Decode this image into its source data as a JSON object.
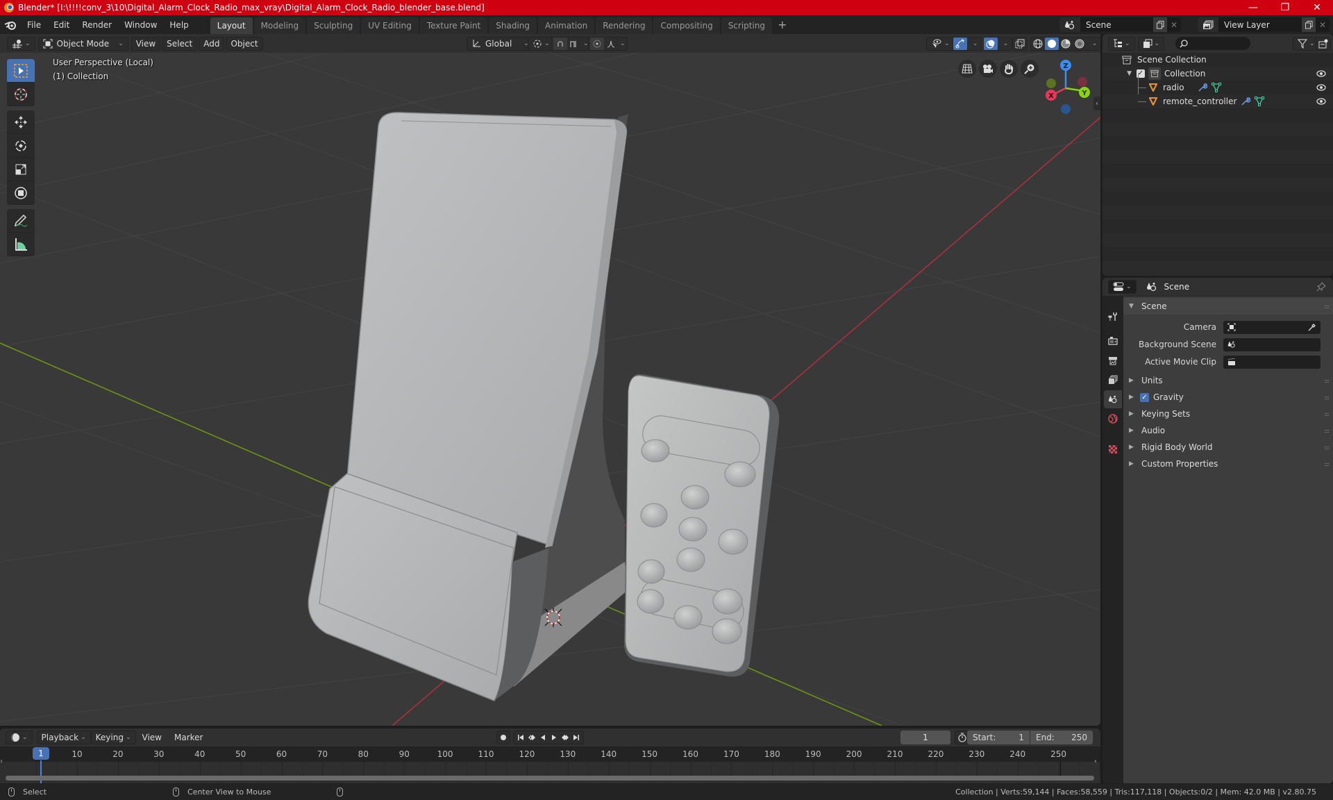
{
  "window": {
    "title": "Blender* [I:\\!!!!conv_3\\10\\Digital_Alarm_Clock_Radio_max_vray\\Digital_Alarm_Clock_Radio_blender_base.blend]",
    "controls": {
      "minimize": "—",
      "maximize": "❐",
      "close": "✕"
    }
  },
  "menu": {
    "items": [
      "File",
      "Edit",
      "Render",
      "Window",
      "Help"
    ]
  },
  "workspaces": {
    "tabs": [
      "Layout",
      "Modeling",
      "Sculpting",
      "UV Editing",
      "Texture Paint",
      "Shading",
      "Animation",
      "Rendering",
      "Compositing",
      "Scripting"
    ],
    "active": "Layout",
    "add_label": "+"
  },
  "scene_selector": {
    "value": "Scene"
  },
  "view_layer_selector": {
    "value": "View Layer"
  },
  "viewport": {
    "header": {
      "mode": "Object Mode",
      "menus": [
        "View",
        "Select",
        "Add",
        "Object"
      ],
      "orientation": "Global"
    },
    "info": {
      "line1": "User Perspective (Local)",
      "line2": "(1) Collection"
    },
    "tools": [
      "select-box",
      "cursor",
      "move",
      "rotate",
      "scale",
      "transform",
      "annotate",
      "measure"
    ],
    "active_tool": "select-box",
    "gizmo_axes": {
      "x": "X",
      "y": "Y",
      "z": "Z"
    },
    "shading_mode": "solid",
    "colors": {
      "x_axis": "#e8375a",
      "y_axis": "#8bd40c",
      "z_axis": "#3a8ef0",
      "accent": "#4772b3"
    }
  },
  "outliner": {
    "search_placeholder": "",
    "root": "Scene Collection",
    "collection": {
      "name": "Collection",
      "checked": true
    },
    "objects": [
      {
        "name": "radio",
        "modifiers": true,
        "mesh": true,
        "visible": true
      },
      {
        "name": "remote_controller",
        "modifiers": true,
        "mesh": true,
        "visible": true
      }
    ]
  },
  "properties": {
    "context": "Scene",
    "panel_title": "Scene",
    "fields": [
      {
        "label": "Camera",
        "value": ""
      },
      {
        "label": "Background Scene",
        "value": ""
      },
      {
        "label": "Active Movie Clip",
        "value": ""
      }
    ],
    "subpanels": [
      {
        "label": "Units",
        "checkbox": false
      },
      {
        "label": "Gravity",
        "checkbox": true,
        "checked": true
      },
      {
        "label": "Keying Sets",
        "checkbox": false
      },
      {
        "label": "Audio",
        "checkbox": false
      },
      {
        "label": "Rigid Body World",
        "checkbox": false
      },
      {
        "label": "Custom Properties",
        "checkbox": false
      }
    ],
    "tabs": [
      "tool",
      "render",
      "output",
      "view-layer",
      "scene",
      "world",
      "texture"
    ],
    "active_tab": "scene"
  },
  "timeline": {
    "menus": [
      "Playback",
      "Keying",
      "View",
      "Marker"
    ],
    "current_frame": "1",
    "start_label": "Start:",
    "start": "1",
    "end_label": "End:",
    "end": "250",
    "ruler": [
      "10",
      "20",
      "30",
      "40",
      "50",
      "60",
      "70",
      "80",
      "90",
      "100",
      "110",
      "120",
      "130",
      "140",
      "150",
      "160",
      "170",
      "180",
      "190",
      "200",
      "210",
      "220",
      "230",
      "240",
      "250"
    ],
    "playhead": "1"
  },
  "statusbar": {
    "left_action": "Select",
    "middle_action": "Center View to Mouse",
    "stats": "Collection | Verts:59,144 | Faces:58,559 | Tris:117,118 | Objects:0/2 | Mem: 42.0 MB | v2.80.75"
  }
}
